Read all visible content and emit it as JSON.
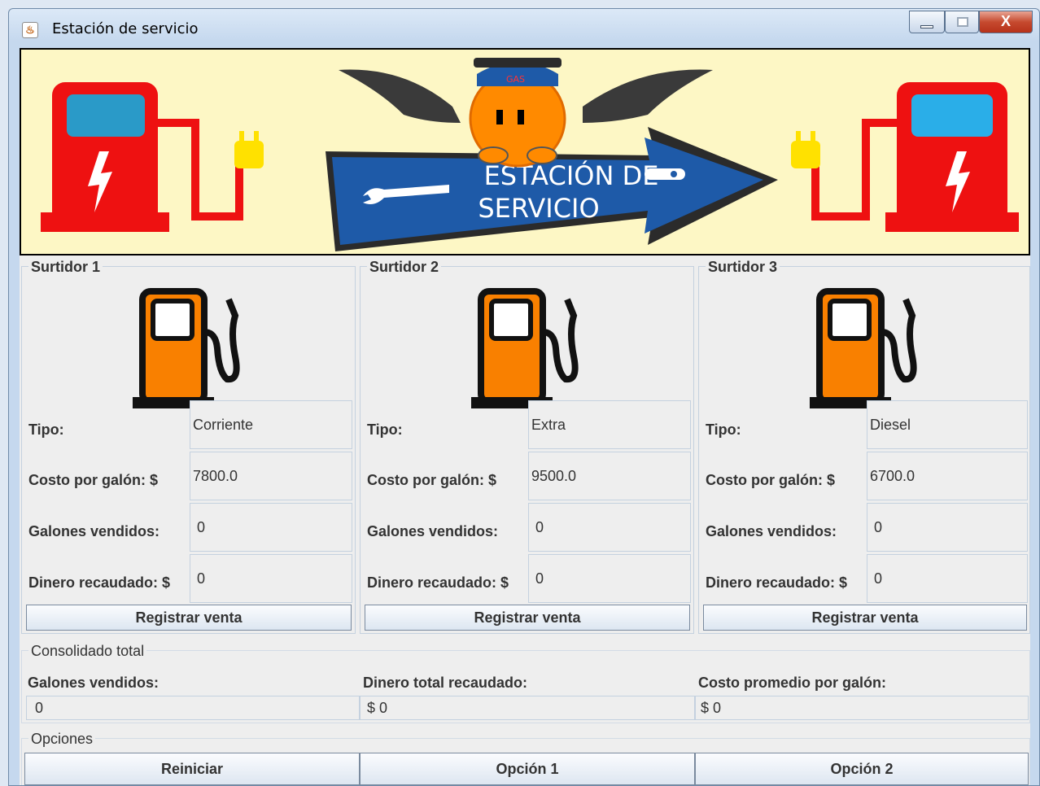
{
  "window": {
    "title": "Estación de servicio",
    "close_glyph": "X"
  },
  "banner": {
    "line1": "ESTACIÓN DE",
    "line2": "SERVICIO",
    "cap_text": "GAS"
  },
  "labels": {
    "tipo": "Tipo:",
    "costo": "Costo por galón: $",
    "galones": "Galones vendidos:",
    "dinero": "Dinero recaudado: $",
    "registrar": "Registrar venta"
  },
  "surtidores": [
    {
      "title": "Surtidor 1",
      "tipo": "Corriente",
      "costo": "7800.0",
      "galones": "0",
      "dinero": "0"
    },
    {
      "title": "Surtidor 2",
      "tipo": "Extra",
      "costo": "9500.0",
      "galones": "0",
      "dinero": "0"
    },
    {
      "title": "Surtidor 3",
      "tipo": "Diesel",
      "costo": "6700.0",
      "galones": "0",
      "dinero": "0"
    }
  ],
  "consolidado": {
    "title": "Consolidado total",
    "galones_label": "Galones vendidos:",
    "galones_value": "0",
    "dinero_label": "Dinero total recaudado:",
    "dinero_value": "$ 0",
    "promedio_label": "Costo promedio por galón:",
    "promedio_value": "$ 0"
  },
  "opciones": {
    "title": "Opciones",
    "reiniciar": "Reiniciar",
    "opcion1": "Opción 1",
    "opcion2": "Opción 2"
  },
  "colors": {
    "pump_orange": "#f98000",
    "charger_red": "#ee1111",
    "arrow_blue": "#1e5aa8",
    "banner_bg": "#fdf7c5"
  }
}
